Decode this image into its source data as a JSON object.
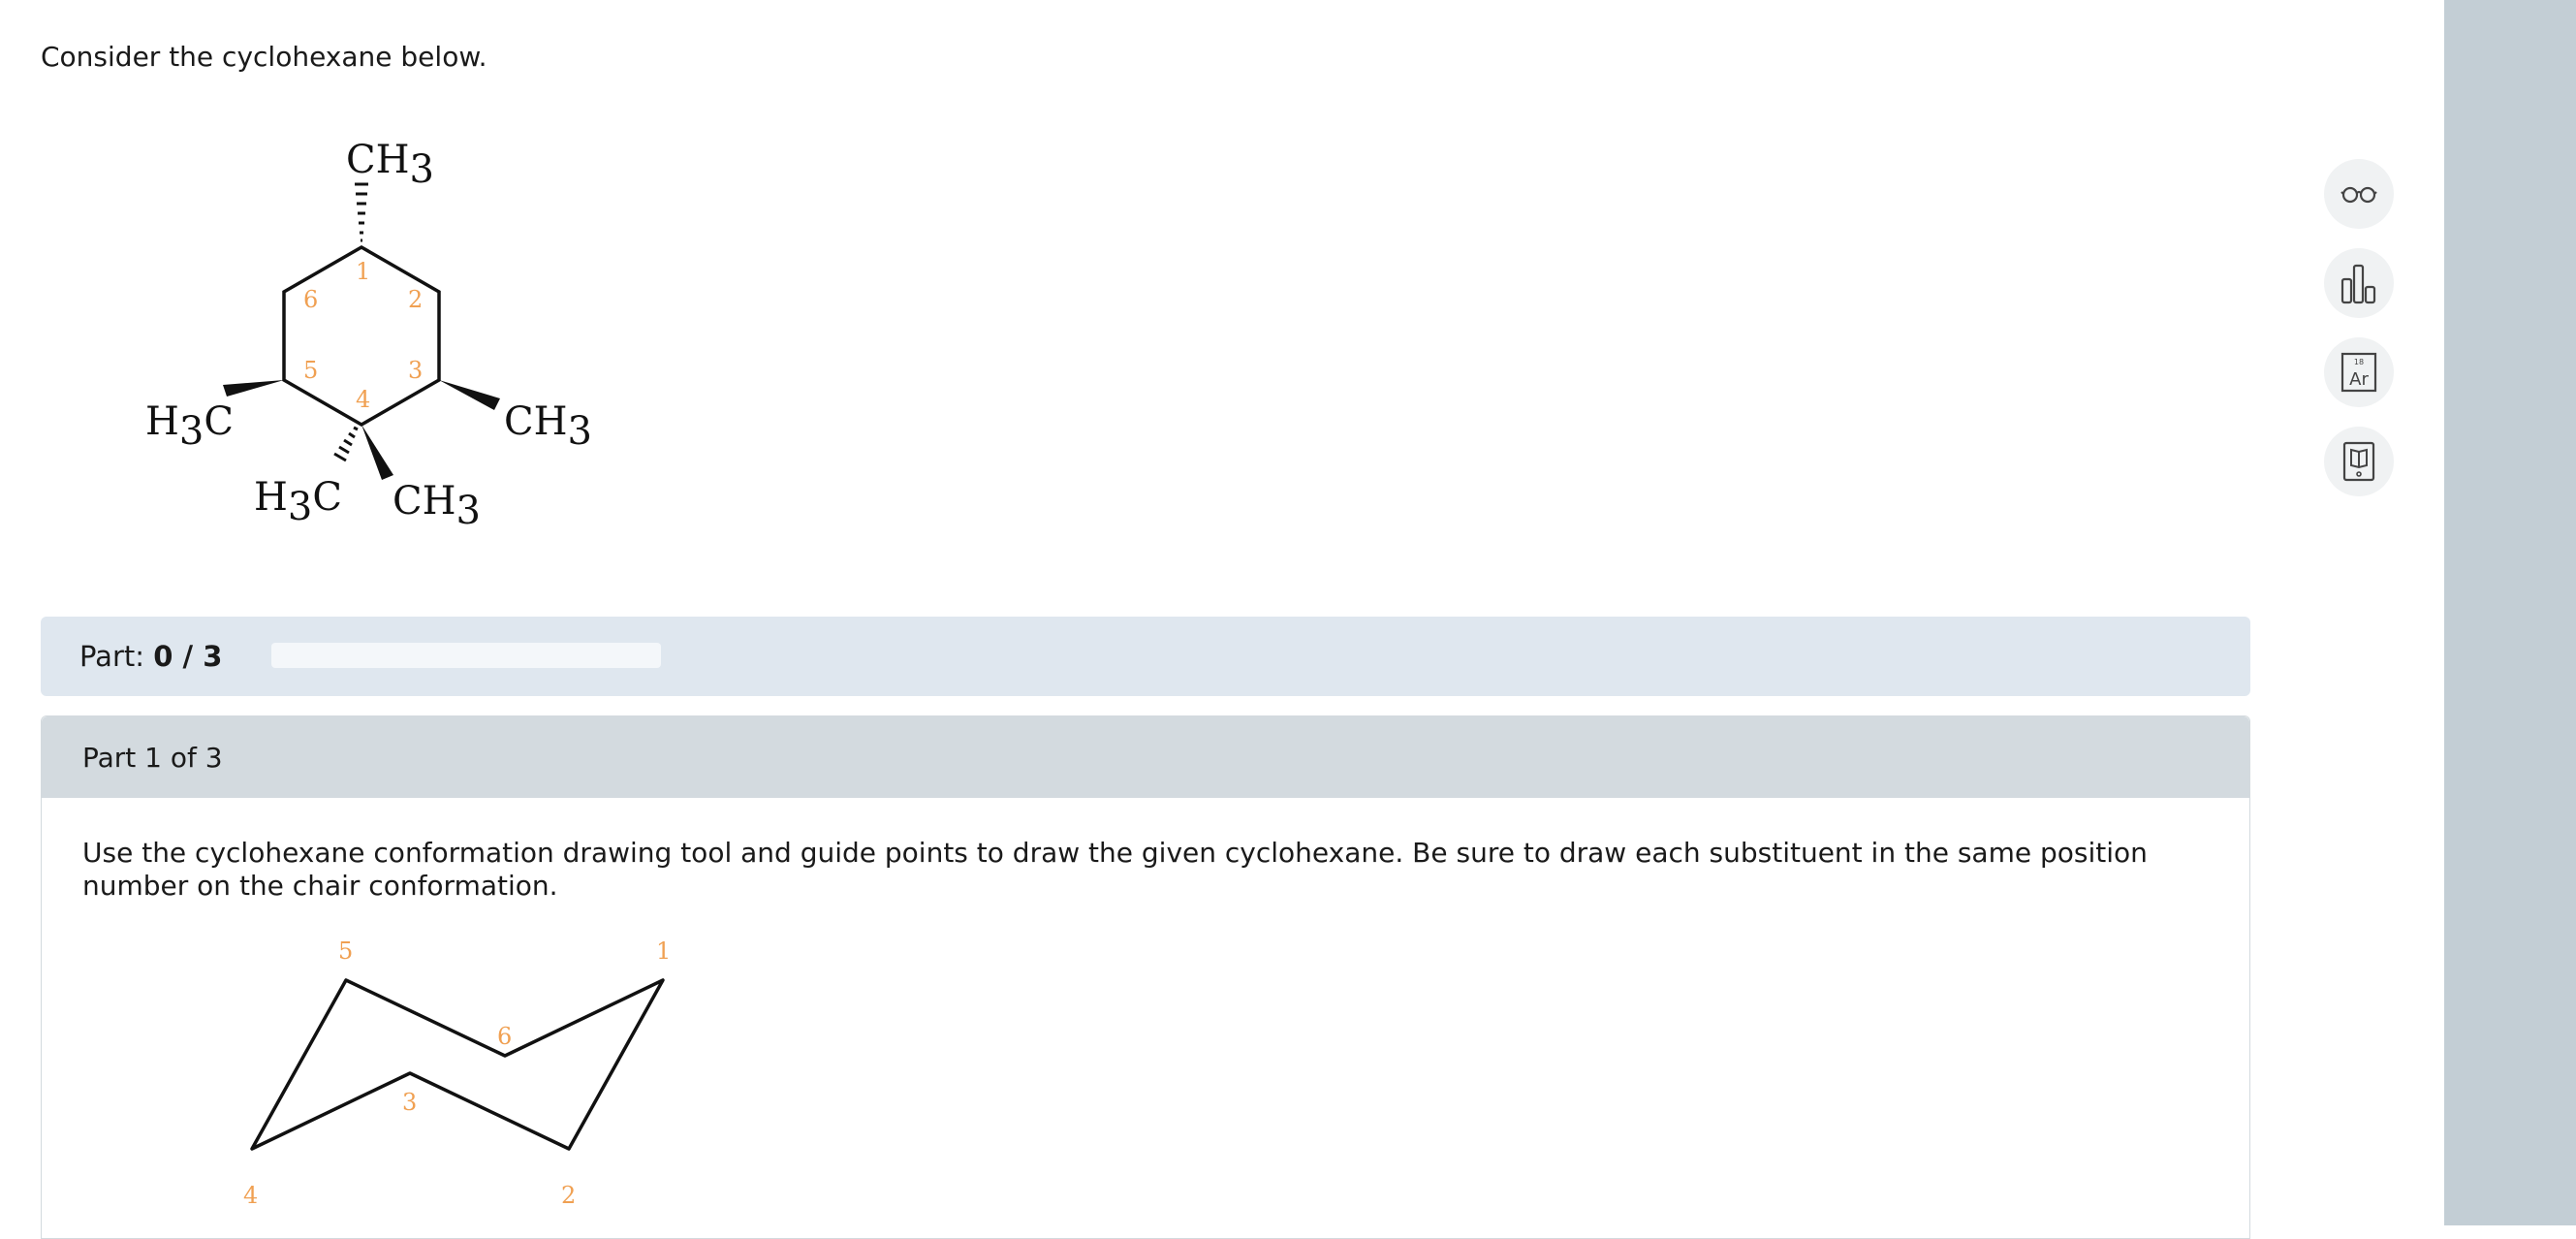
{
  "intro_text": "Consider the cyclohexane below.",
  "molecule": {
    "top_group": {
      "main": "CH",
      "sub": "3"
    },
    "left_group": {
      "pre": "H",
      "sub": "3",
      "post": "C"
    },
    "right_group": {
      "main": "CH",
      "sub": "3"
    },
    "bottom_left_group": {
      "pre": "H",
      "sub": "3",
      "post": "C"
    },
    "bottom_right_group": {
      "main": "CH",
      "sub": "3"
    },
    "numbers": [
      "1",
      "2",
      "3",
      "4",
      "5",
      "6"
    ]
  },
  "progress": {
    "label": "Part:",
    "value": "0 / 3",
    "fraction": 0
  },
  "part": {
    "header": "Part 1 of 3",
    "instructions": "Use the cyclohexane conformation drawing tool and guide points to draw the given cyclohexane. Be sure to draw each substituent in the same position number on the chair conformation.",
    "chair_numbers": [
      "1",
      "2",
      "3",
      "4",
      "5",
      "6"
    ]
  },
  "tools": [
    {
      "icon": "glasses-icon"
    },
    {
      "icon": "bar-chart-icon"
    },
    {
      "icon": "periodic-table-icon",
      "element_symbol": "Ar",
      "atomic_number": "18"
    },
    {
      "icon": "textbook-icon"
    }
  ]
}
